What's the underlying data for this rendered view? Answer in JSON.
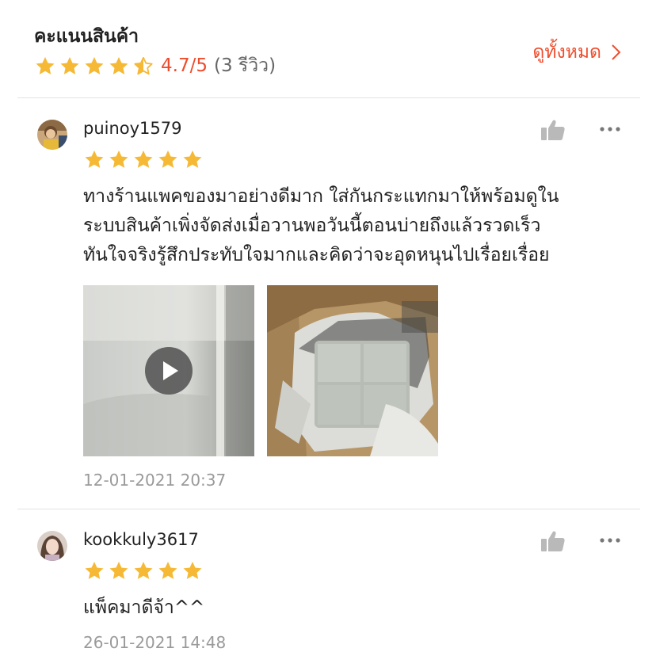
{
  "header": {
    "title": "คะแนนสินค้า",
    "rating_value": "4.7/5",
    "review_count": "(3 รีวิว)",
    "rating_fraction": 0.94,
    "see_all_label": "ดูทั้งหมด"
  },
  "colors": {
    "accent": "#ee4d2d",
    "star": "#f6b935",
    "text": "#222222",
    "muted": "#9a9a9a",
    "divider": "#e3e3e3"
  },
  "reviews": [
    {
      "username": "puinoy1579",
      "stars": 5,
      "text_lines": [
        "ทางร้านแพคของมาอย่างดีมาก ใส่กันกระแทกมาให้พร้อมดูใน",
        "ระบบสินค้าเพิ่งจัดส่งเมื่อวานพอวันนี้ตอนบ่ายถึงแล้วรวดเร็ว",
        "ทันใจจริงรู้สึกประทับใจมากและคิดว่าจะอุดหนุนไปเรื่อยเรื่อย"
      ],
      "media": [
        {
          "kind": "video",
          "icon": "play-icon"
        },
        {
          "kind": "photo"
        }
      ],
      "date": "12-01-2021 20:37"
    },
    {
      "username": "kookkuly3617",
      "stars": 5,
      "text_lines": [
        "แพ็คมาดีจ้า^^"
      ],
      "date": "26-01-2021 14:48"
    }
  ],
  "icons": {
    "like": "thumbs-up-icon",
    "more": "more-dots-icon",
    "chevron": "chevron-right-icon",
    "star": "star-icon"
  }
}
